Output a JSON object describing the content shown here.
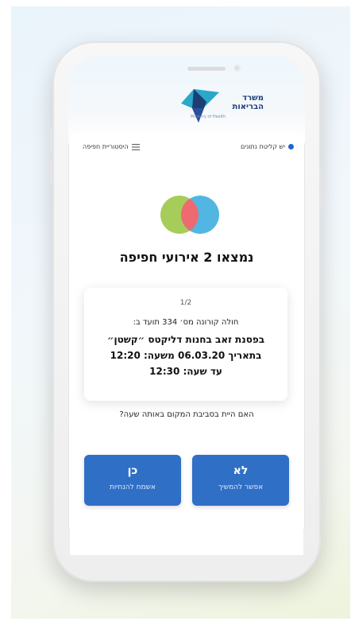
{
  "header": {
    "logo_line1": "משרד",
    "logo_line2": "הבריאות",
    "logo_sub": "Ministry of Health"
  },
  "status": {
    "connection_label": "יש קליטת נתונים",
    "history_label": "היסטוריית חפיפה"
  },
  "main": {
    "headline": "נמצאו 2 אירועי חפיפה",
    "question": "האם היית בסביבת המקום באותה שעה?"
  },
  "event_card": {
    "pager": "1/2",
    "patient_line": "חולה קורונה מס׳ 334 תועד ב:",
    "location_line": "בפסנת זאב בחנות דליקטס ״קשטן״",
    "date_line": "בתאריך 06.03.20 משעה: 12:20",
    "until_line": "עד שעה: 12:30"
  },
  "buttons": {
    "no_title": "לא",
    "no_subtitle": "אפשר להמשיך",
    "yes_title": "כן",
    "yes_subtitle": "אשמח להנחיות"
  },
  "colors": {
    "button_blue": "#2f6fc6",
    "status_dot": "#1e66d0",
    "circle_green": "#a6cd5a",
    "circle_blue": "#52b6e3",
    "circle_overlap": "#ec6a70"
  },
  "icons": {
    "status": "status-dot-icon",
    "history": "menu-lines-icon"
  }
}
